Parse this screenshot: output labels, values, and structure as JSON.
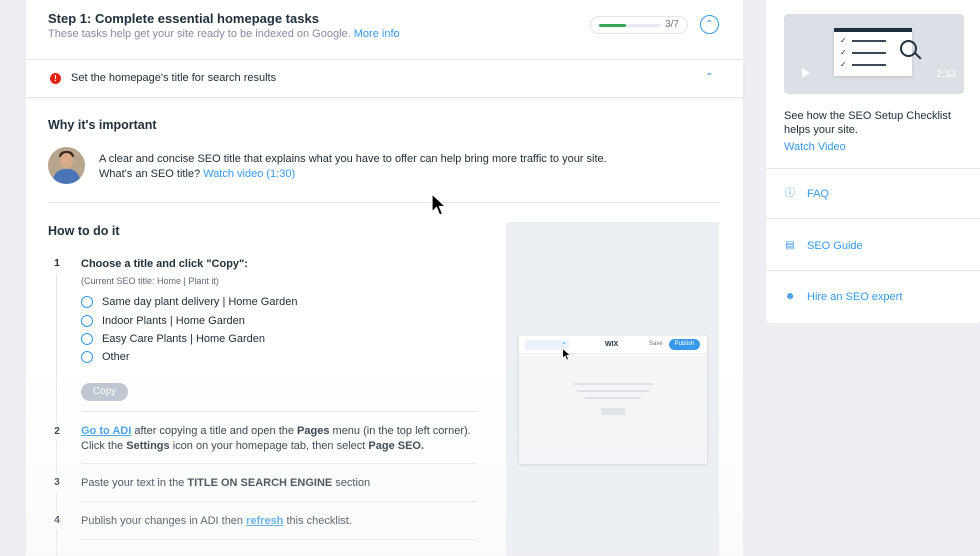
{
  "header": {
    "title": "Step 1: Complete essential homepage tasks",
    "subtitle": "These tasks help get your site ready to be indexed on Google.",
    "more_info": "More info",
    "progress_text": "3/7",
    "progress_fraction": 0.43,
    "collapse_icon": "chevron-up-icon"
  },
  "task": {
    "alert_icon": "exclamation-icon",
    "text": "Set the homepage's title for search results",
    "chevron_icon": "chevron-up-icon"
  },
  "why": {
    "title": "Why it's important",
    "text": "A clear and concise SEO title that explains what you have to offer can help bring more traffic to your site.",
    "question": "What's an SEO title?",
    "watch_link": "Watch video (1:30)"
  },
  "how": {
    "title": "How to do it",
    "step1": {
      "num": "1",
      "heading": "Choose a title and click \"Copy\":",
      "note": "(Current SEO title: Home | Plant it)",
      "options": [
        "Same day plant delivery | Home Garden",
        "Indoor Plants | Home Garden",
        "Easy Care Plants | Home Garden",
        "Other"
      ],
      "copy_label": "Copy"
    },
    "step2": {
      "num": "2",
      "link": "Go to ADI",
      "text_a": " after copying a title and open the ",
      "bold_a": "Pages",
      "text_b": " menu (in the top left corner). Click the ",
      "bold_b": "Settings",
      "text_c": " icon on your homepage tab, then select ",
      "bold_c": "Page SEO."
    },
    "step3": {
      "num": "3",
      "text_a": "Paste your text in the ",
      "bold": "TITLE ON SEARCH ENGINE",
      "text_b": " section"
    },
    "step4": {
      "num": "4",
      "text_a": "Publish your changes in ADI then ",
      "link": "refresh",
      "text_b": " this checklist."
    }
  },
  "preview": {
    "logo": "WIX",
    "save": "Save",
    "publish": "Publish"
  },
  "sidebar": {
    "video_duration": "2:33",
    "video_desc": "See how the SEO Setup Checklist helps your site.",
    "watch_label": "Watch Video",
    "links": [
      {
        "label": "FAQ",
        "icon": "question-circle-icon"
      },
      {
        "label": "SEO Guide",
        "icon": "guide-icon"
      },
      {
        "label": "Hire an SEO expert",
        "icon": "person-icon"
      }
    ]
  }
}
